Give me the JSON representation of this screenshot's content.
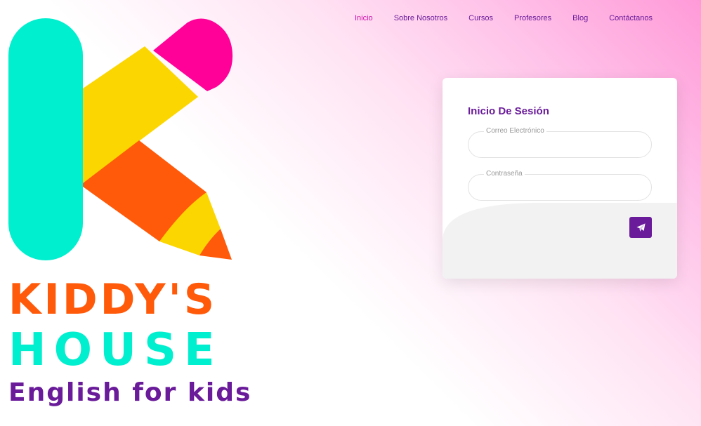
{
  "nav": {
    "items": [
      {
        "label": "Inicio",
        "active": true
      },
      {
        "label": "Sobre Nosotros",
        "active": false
      },
      {
        "label": "Cursos",
        "active": false
      },
      {
        "label": "Profesores",
        "active": false
      },
      {
        "label": "Blog",
        "active": false
      },
      {
        "label": "Contáctanos",
        "active": false
      }
    ]
  },
  "brand": {
    "line1": "KIDDY'S",
    "line2": "HOUSE",
    "line3": "English for kids"
  },
  "login": {
    "title": "Inicio De Sesión",
    "email_label": "Correo Electrónico",
    "email_value": "",
    "password_label": "Contraseña",
    "password_value": "",
    "submit_icon": "paper-plane-icon"
  },
  "colors": {
    "purple": "#6a1b9a",
    "magenta": "#ff0099",
    "teal": "#00efcf",
    "orange": "#ff5a0a",
    "yellow": "#fcd600",
    "active_nav": "#cc11aa"
  }
}
